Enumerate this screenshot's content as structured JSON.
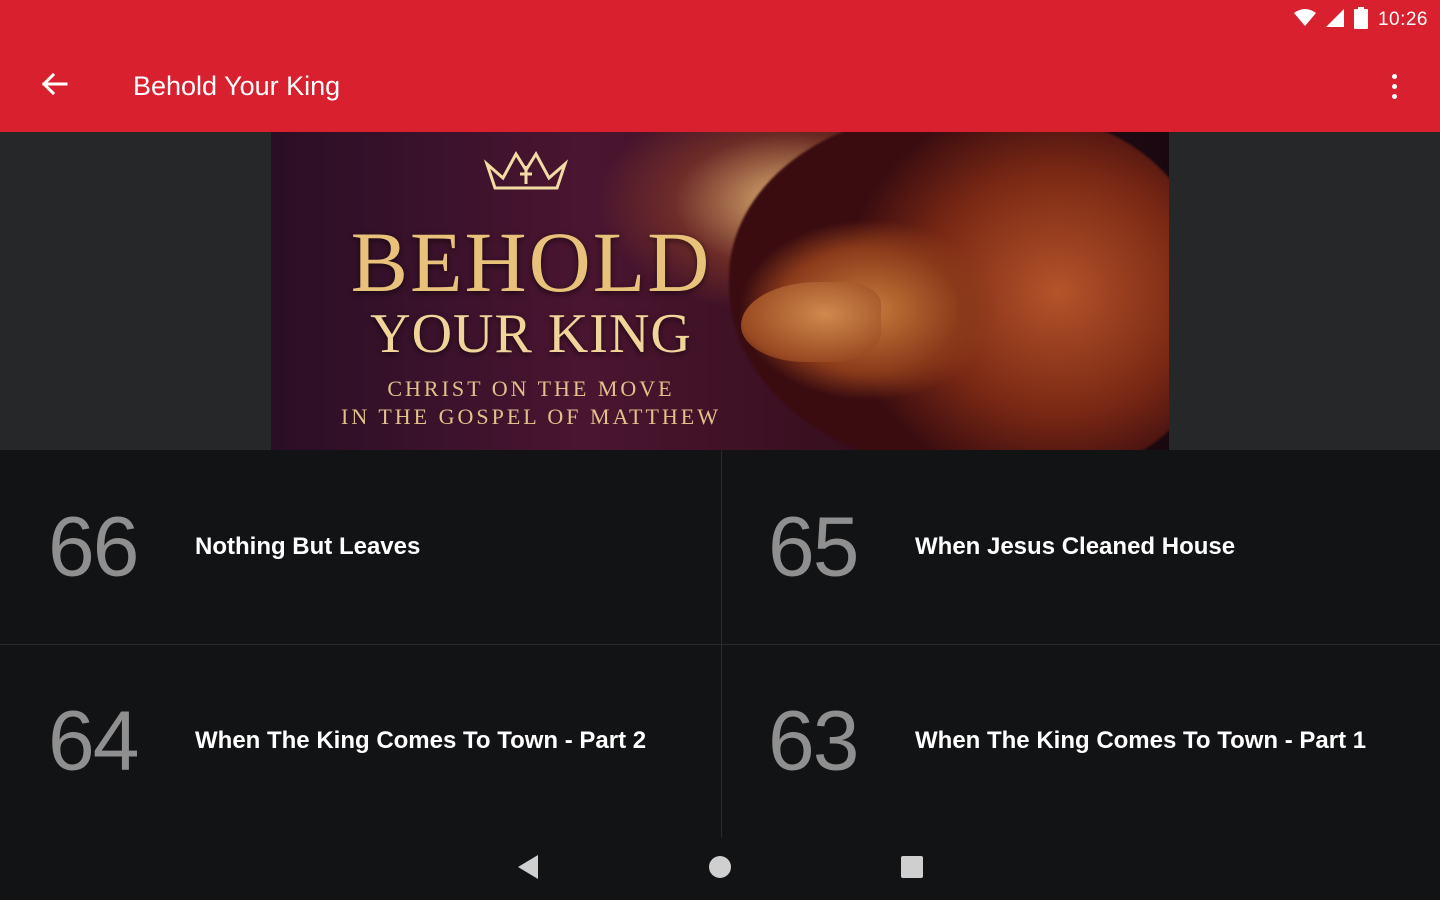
{
  "status_bar": {
    "time": "10:26",
    "icons": [
      "wifi-icon",
      "cell-signal-icon",
      "battery-icon"
    ]
  },
  "app_bar": {
    "title": "Behold Your King",
    "back_icon": "arrow-left-icon",
    "menu_icon": "more-vert-icon",
    "color": "#d8202f"
  },
  "banner": {
    "title_line1": "BEHOLD",
    "title_line2": "YOUR KING",
    "subtitle_line1": "CHRIST ON THE MOVE",
    "subtitle_line2": "IN THE GOSPEL OF MATTHEW"
  },
  "sermons": [
    {
      "number": "66",
      "title": "Nothing But Leaves"
    },
    {
      "number": "65",
      "title": "When Jesus Cleaned House"
    },
    {
      "number": "64",
      "title": "When The King Comes To Town - Part 2"
    },
    {
      "number": "63",
      "title": "When The King Comes To Town - Part 1"
    }
  ],
  "nav_bar": {
    "icons": [
      "back-triangle-icon",
      "home-circle-icon",
      "recents-square-icon"
    ]
  }
}
